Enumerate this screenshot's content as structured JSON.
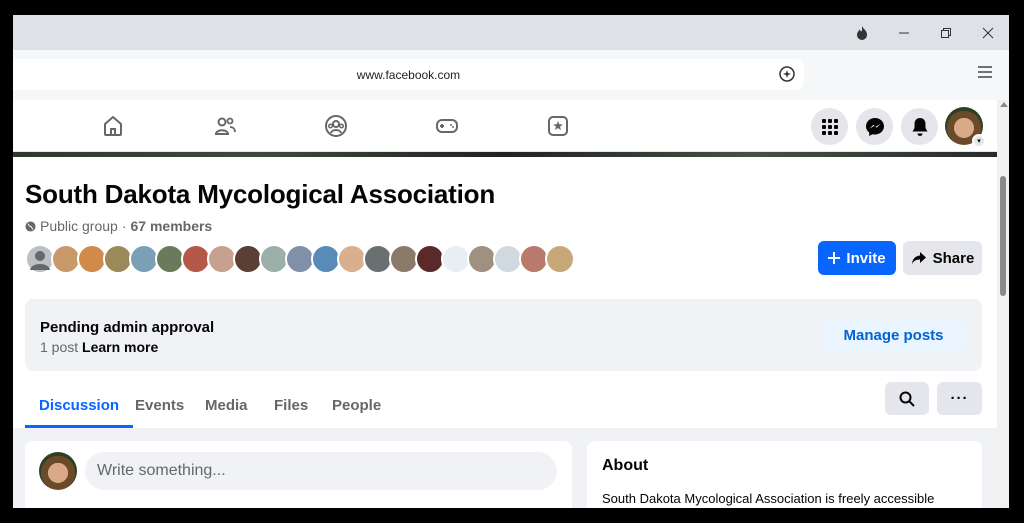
{
  "browser": {
    "url": "www.facebook.com",
    "icons": {
      "fire": "flame-icon",
      "minimize": "minimize-icon",
      "restore": "restore-icon",
      "close": "close-icon",
      "menu": "hamburger-icon"
    }
  },
  "nav": {
    "tabs": [
      "home-icon",
      "friends-icon",
      "groups-icon",
      "gaming-icon",
      "feeds-icon"
    ],
    "right": [
      "menu-grid-icon",
      "messenger-icon",
      "notifications-icon"
    ]
  },
  "group": {
    "title": "South Dakota Mycological Association",
    "privacy": "Public group",
    "separator": "·",
    "members": "67 members",
    "invite_label": "Invite",
    "share_label": "Share"
  },
  "pending": {
    "title": "Pending admin approval",
    "count": "1 post",
    "learn_more": "Learn more",
    "manage_label": "Manage posts"
  },
  "tabs": [
    "Discussion",
    "Events",
    "Media",
    "Files",
    "People"
  ],
  "composer": {
    "placeholder": "Write something..."
  },
  "about": {
    "title": "About",
    "text": "South Dakota Mycological Association is freely accessible"
  },
  "colors": {
    "accent": "#0866ff",
    "page_bg": "#f0f2f5",
    "manage_bg": "#ebf5ff",
    "manage_text": "#0064d1"
  }
}
